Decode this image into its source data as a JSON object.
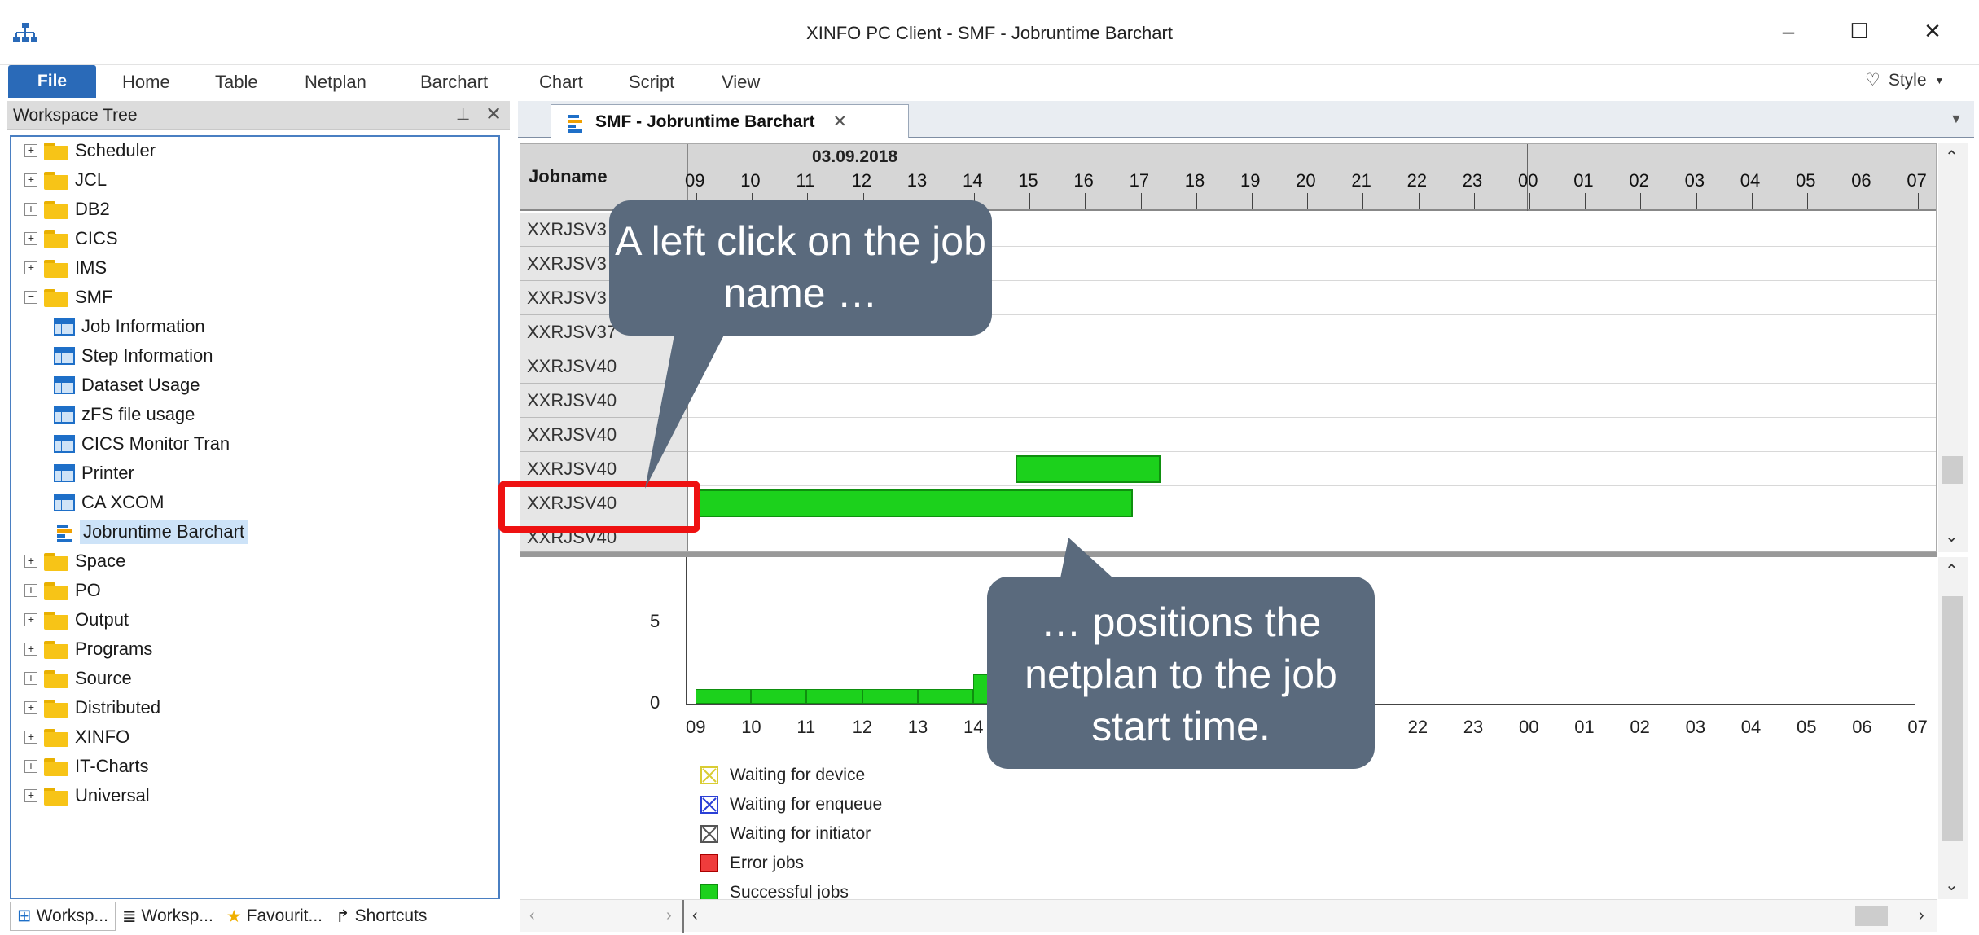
{
  "window": {
    "title": "XINFO PC Client - SMF - Jobruntime Barchart",
    "minimize": "–",
    "maximize": "☐",
    "close": "✕"
  },
  "ribbon": {
    "tabs": [
      "File",
      "Home",
      "Table",
      "Netplan",
      "Barchart",
      "Chart",
      "Script",
      "View"
    ],
    "style_label": "Style"
  },
  "workspace_tree": {
    "title": "Workspace Tree",
    "items": [
      "Scheduler",
      "JCL",
      "DB2",
      "CICS",
      "IMS",
      "SMF"
    ],
    "smf_children": [
      "Job Information",
      "Step Information",
      "Dataset Usage",
      "zFS file usage",
      "CICS Monitor Tran",
      "Printer",
      "CA XCOM",
      "Jobruntime Barchart"
    ],
    "after_items": [
      "Space",
      "PO",
      "Output",
      "Programs",
      "Source",
      "Distributed",
      "XINFO",
      "IT-Charts",
      "Universal"
    ]
  },
  "bottom_tabs": [
    "Worksp...",
    "Worksp...",
    "Favourit...",
    "Shortcuts"
  ],
  "document_tab": {
    "label": "SMF - Jobruntime Barchart",
    "close": "✕"
  },
  "gantt": {
    "job_header": "Jobname",
    "date": "03.09.2018",
    "hours": [
      "09",
      "10",
      "11",
      "12",
      "13",
      "14",
      "15",
      "16",
      "17",
      "18",
      "19",
      "20",
      "21",
      "22",
      "23",
      "00",
      "01",
      "02",
      "03",
      "04",
      "05",
      "06",
      "07"
    ],
    "rows": [
      "XXRJSV3",
      "XXRJSV3",
      "XXRJSV3",
      "XXRJSV37",
      "XXRJSV40",
      "XXRJSV40",
      "XXRJSV40",
      "XXRJSV40",
      "XXRJSV40",
      "XXRJSV40"
    ]
  },
  "chart_data": {
    "type": "bar",
    "x_categories": [
      "09",
      "10",
      "11",
      "12",
      "13",
      "14",
      "15",
      "16",
      "17",
      "18",
      "19",
      "20",
      "21",
      "22",
      "23",
      "00",
      "01",
      "02",
      "03",
      "04",
      "05",
      "06",
      "07"
    ],
    "y_ticks": [
      "0",
      "5"
    ],
    "series": [
      {
        "name": "Successful jobs",
        "values": [
          1,
          1,
          1,
          1,
          1,
          2,
          2,
          2,
          0,
          0,
          0,
          0,
          0,
          0,
          0,
          0,
          0,
          0,
          0,
          0,
          0,
          0,
          0
        ]
      }
    ],
    "legend": [
      "Waiting for device",
      "Waiting for enqueue",
      "Waiting for initiator",
      "Error jobs",
      "Successful jobs"
    ],
    "legend_colors": [
      "#d9cc33",
      "#2a3fd6",
      "#555555",
      "#ef3c3c",
      "#1cd11c"
    ]
  },
  "callouts": {
    "left": "A left click on the job name …",
    "right": "… positions the netplan to the job start time."
  },
  "colors": {
    "accent": "#2a6ab8",
    "bar_green": "#1cd11c",
    "callout": "#5a6a7d",
    "highlight": "#ee1111"
  }
}
